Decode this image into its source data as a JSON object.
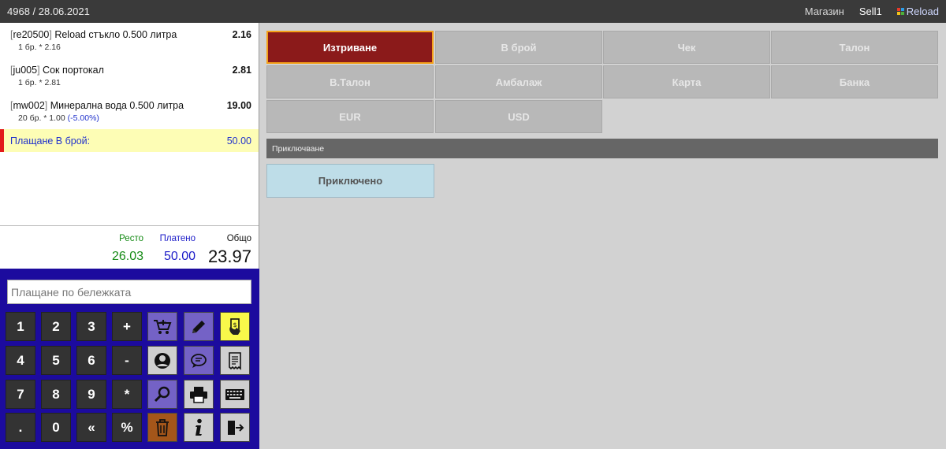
{
  "topbar": {
    "doc": "4968 / 28.06.2021",
    "shop": "Магазин",
    "user": "Sell1",
    "brand": "Reload"
  },
  "receipt": {
    "items": [
      {
        "code": "re20500",
        "name": "Reload стъкло 0.500 литра",
        "price": "2.16",
        "qty": "1 бр. * 2.16",
        "discount": ""
      },
      {
        "code": "ju005",
        "name": "Сок портокал",
        "price": "2.81",
        "qty": "1 бр. * 2.81",
        "discount": ""
      },
      {
        "code": "mw002",
        "name": "Минерална вода 0.500 литра",
        "price": "19.00",
        "qty": "20 бр. * 1.00",
        "discount": "(-5.00%)"
      }
    ],
    "payment": {
      "label": "Плащане В брой:",
      "amount": "50.00"
    }
  },
  "totals": {
    "change_label": "Ресто",
    "change": "26.03",
    "paid_label": "Платено",
    "paid": "50.00",
    "total_label": "Общо",
    "total": "23.97"
  },
  "keypad": {
    "note_placeholder": "Плащане по бележката",
    "keys": [
      "1",
      "2",
      "3",
      "+",
      "4",
      "5",
      "6",
      "-",
      "7",
      "8",
      "9",
      "*",
      ".",
      "0",
      "«",
      "%"
    ]
  },
  "payments": {
    "delete": "Изтриване",
    "cash": "В брой",
    "cheque": "Чек",
    "coupon": "Талон",
    "vcoupon": "В.Талон",
    "packaging": "Амбалаж",
    "card": "Карта",
    "bank": "Банка",
    "eur": "EUR",
    "usd": "USD"
  },
  "finish": {
    "section_label": "Приключване",
    "done_label": "Приключено"
  },
  "colors": {
    "accent_red": "#8b1a1a",
    "keypad_bg": "#1c0b9e",
    "payment_row": "#fdfdb5"
  }
}
